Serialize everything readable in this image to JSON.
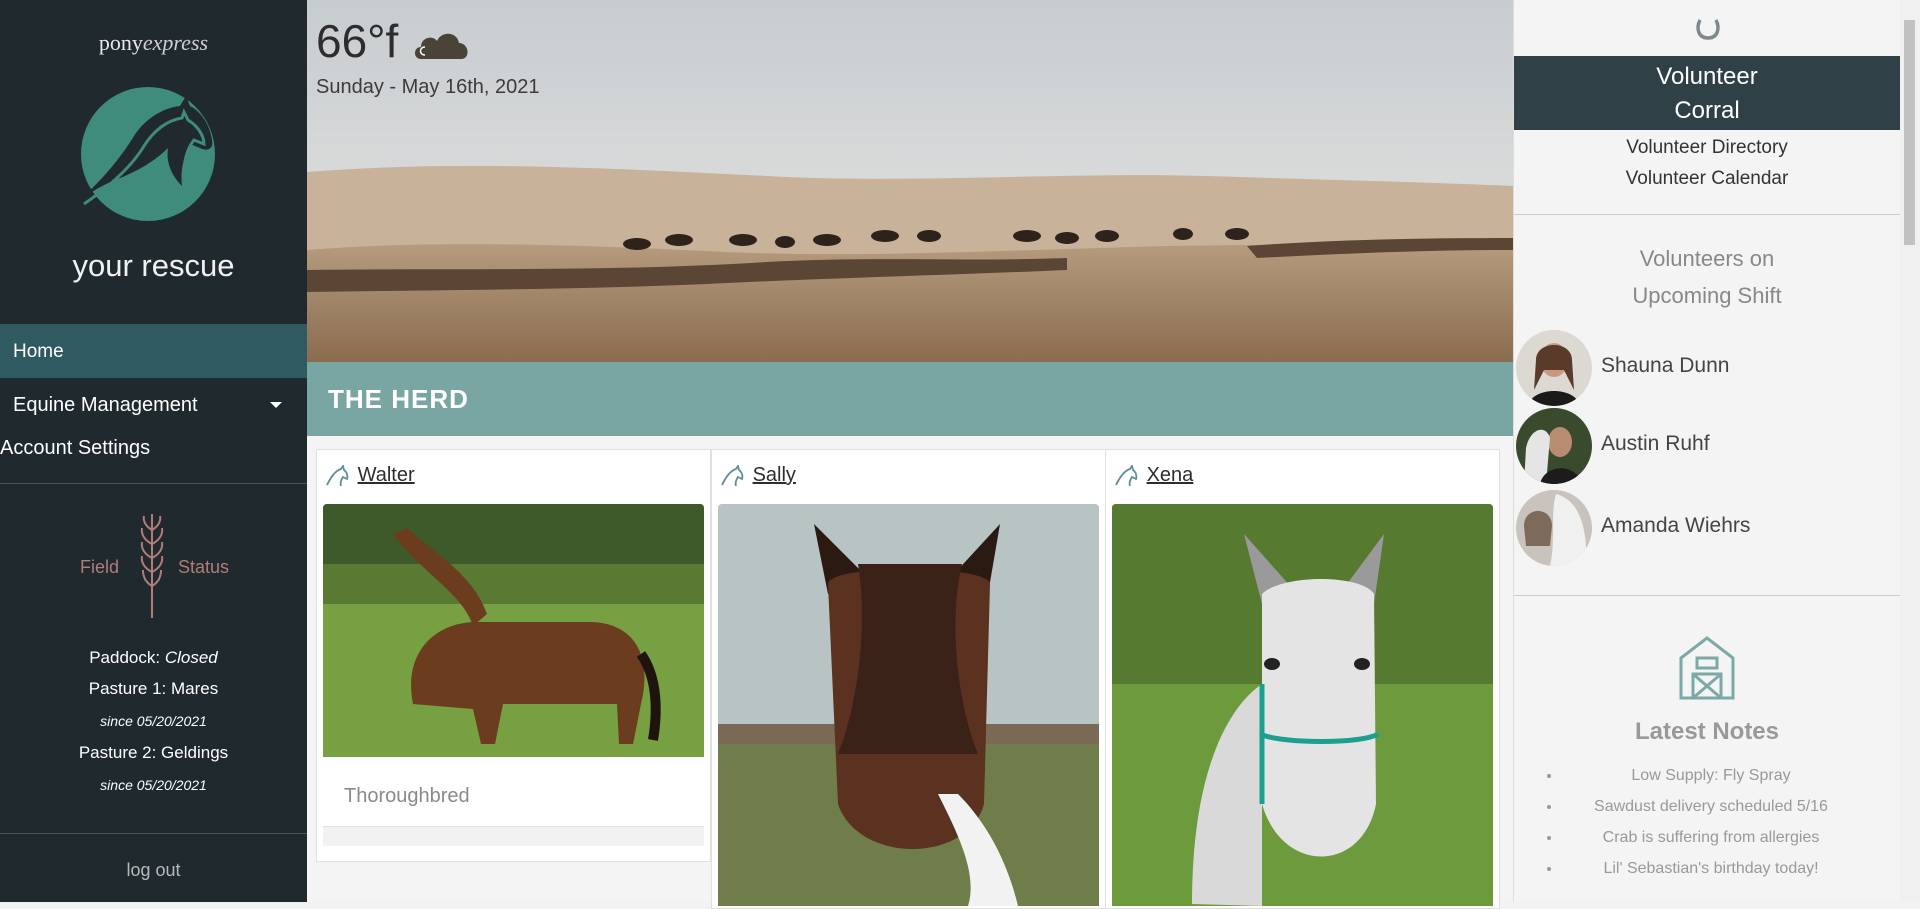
{
  "sidebar": {
    "brand_prefix": "pony",
    "brand_suffix": "express",
    "rescue_name": "your rescue",
    "nav": {
      "home": "Home",
      "equine": "Equine Management",
      "account": "Account Settings"
    },
    "field_status": {
      "field_label": "Field",
      "status_label": "Status",
      "paddock_label": "Paddock:",
      "paddock_value": "Closed",
      "pasture1": "Pasture 1: Mares",
      "pasture1_since": "since 05/20/2021",
      "pasture2": "Pasture 2: Geldings",
      "pasture2_since": "since 05/20/2021"
    },
    "logout": "log out"
  },
  "hero": {
    "temperature": "66°f",
    "weather_icon": "cloud-icon",
    "date": "Sunday - May 16th, 2021"
  },
  "herd": {
    "title": "THE HERD",
    "horses": [
      {
        "name": "Walter",
        "breed": "Thoroughbred"
      },
      {
        "name": "Sally"
      },
      {
        "name": "Xena"
      }
    ]
  },
  "right_panel": {
    "top_icon": "horseshoe-icon",
    "banner_line1": "Volunteer",
    "banner_line2": "Corral",
    "links": [
      "Volunteer Directory",
      "Volunteer Calendar"
    ],
    "shift_title_line1": "Volunteers on",
    "shift_title_line2": "Upcoming Shift",
    "volunteers": [
      "Shauna Dunn",
      "Austin Ruhf",
      "Amanda Wiehrs"
    ],
    "notes_icon": "barn-icon",
    "notes_title": "Latest Notes",
    "notes": [
      "Low Supply: Fly Spray",
      "Sawdust delivery scheduled 5/16",
      "Crab is suffering from allergies",
      "Lil' Sebastian's birthday today!"
    ]
  },
  "colors": {
    "sidebar_bg": "#1f292e",
    "nav_active": "#2f5a62",
    "herd_band": "#79a6a3",
    "banner": "#2f4147",
    "logo_teal": "#3f8b7c"
  }
}
